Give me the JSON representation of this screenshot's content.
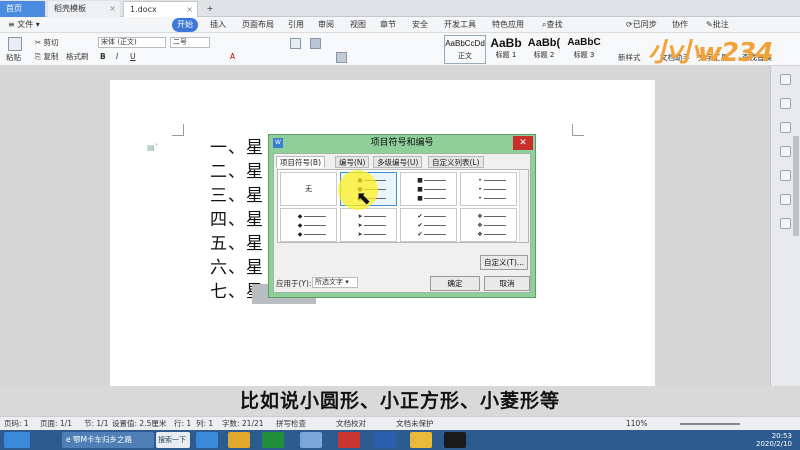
{
  "tabs": {
    "home": "首页",
    "template": "稻壳模板",
    "document": "1.docx"
  },
  "menu": {
    "file": "文件",
    "start": "开始",
    "insert": "插入",
    "layout": "页面布局",
    "reference": "引用",
    "review": "审阅",
    "view": "视图",
    "chapter": "章节",
    "security": "安全",
    "dev": "开发工具",
    "special": "特色应用",
    "search": "查找",
    "sync": "已同步",
    "collab": "协作",
    "comment": "批注"
  },
  "ribbon": {
    "paste": "粘贴",
    "cut": "剪切",
    "copy": "复制",
    "format_painter": "格式刷",
    "font": "宋体 (正文)",
    "size": "二号",
    "styles": [
      {
        "sample": "AaBbCcDd",
        "name": "正文"
      },
      {
        "sample": "AaBb",
        "name": "标题 1"
      },
      {
        "sample": "AaBb(",
        "name": "标题 2"
      },
      {
        "sample": "AaBbC",
        "name": "标题 3"
      }
    ],
    "new_style": "新样式",
    "doc_helper": "文档助手",
    "text_tool": "文字工具",
    "find_replace": "查找替换",
    "select": "选"
  },
  "document": {
    "lines": [
      "一、星",
      "二、星",
      "三、星",
      "四、星",
      "五、星",
      "六、星",
      "七、星"
    ]
  },
  "dialog": {
    "title": "项目符号和编号",
    "tabs": [
      "项目符号(B)",
      "编号(N)",
      "多级编号(U)",
      "自定义列表(L)"
    ],
    "none_label": "无",
    "customize": "自定义(T)...",
    "apply_label": "应用于(Y):",
    "apply_value": "所选文字",
    "ok": "确定",
    "cancel": "取消",
    "bullets": [
      [
        "",
        "●",
        "■",
        ""
      ],
      [
        "◆",
        "➤",
        "✔",
        "❖"
      ]
    ]
  },
  "caption": "比如说小圆形、小正方形、小菱形等",
  "status": {
    "page_num": "页码: 1",
    "page": "页面: 1/1",
    "section": "节: 1/1",
    "setting": "设置值: 2.5厘米",
    "row": "行: 1",
    "col": "列: 1",
    "words": "字数: 21/21",
    "spell": "拼写检查",
    "proof": "文档校对",
    "protect": "文档未保护",
    "zoom": "110%"
  },
  "taskbar": {
    "item1": "鄂M卡车归乡之路",
    "search": "搜索一下",
    "time": "20:53",
    "date": "2020/2/10"
  },
  "watermark": "小小w234"
}
